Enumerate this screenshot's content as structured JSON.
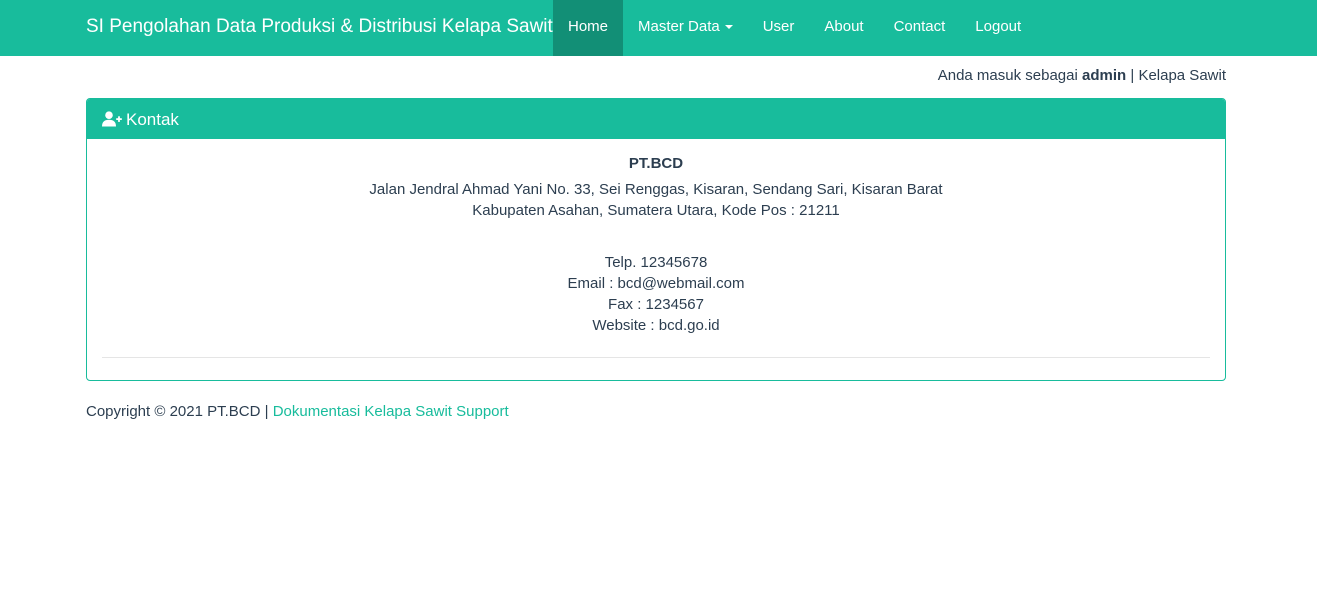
{
  "navbar": {
    "brand": "SI Pengolahan Data Produksi & Distribusi Kelapa Sawit",
    "items": [
      {
        "label": "Home",
        "active": true
      },
      {
        "label": "Master Data",
        "dropdown": true
      },
      {
        "label": "User"
      },
      {
        "label": "About"
      },
      {
        "label": "Contact"
      },
      {
        "label": "Logout"
      }
    ]
  },
  "login_info": {
    "prefix": "Anda masuk sebagai",
    "user": "admin",
    "separator": "|",
    "app": "Kelapa Sawit"
  },
  "panel": {
    "icon": "user-plus-icon",
    "title": "Kontak",
    "company": "PT.BCD",
    "address_line1": "Jalan Jendral Ahmad Yani No. 33, Sei Renggas, Kisaran, Sendang Sari, Kisaran Barat",
    "address_line2": "Kabupaten Asahan, Sumatera Utara, Kode Pos : 21211",
    "phone": "Telp. 12345678",
    "email": "Email : bcd@webmail.com",
    "fax": "Fax : 1234567",
    "website": "Website : bcd.go.id"
  },
  "footer": {
    "copyright": "Copyright © 2021 PT.BCD |",
    "link": "Dokumentasi Kelapa Sawit Support"
  },
  "colors": {
    "primary": "#18bc9c",
    "primary_dark": "#128f76",
    "text": "#2c3e50"
  }
}
